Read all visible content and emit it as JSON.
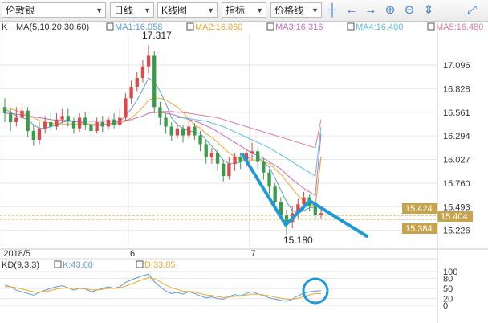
{
  "toolbar": {
    "symbol": "伦敦银",
    "period": "日线",
    "chart_type": "K线图",
    "indicator": "指标",
    "price_line": "价格线",
    "icons": [
      "crosshair-icon",
      "arrow-left-icon",
      "arrow-right-icon",
      "zoom-in-icon",
      "zoom-out-icon",
      "fit-icon",
      "fullscreen-icon"
    ]
  },
  "ma_legend": {
    "prefix": "K",
    "params": "MA(5,10,20,30,60)",
    "items": [
      {
        "label": "MA1:16.058",
        "color": "#5b9bd5"
      },
      {
        "label": "MA2:16.060",
        "color": "#f0a830"
      },
      {
        "label": "MA3:16.316",
        "color": "#c06cc0"
      },
      {
        "label": "MA4:16.400",
        "color": "#5bc0de"
      },
      {
        "label": "MA5:16.480",
        "color": "#e07c9c"
      }
    ]
  },
  "kd_legend": {
    "params": "KD(9,3,3)",
    "items": [
      {
        "label": "K:43.60",
        "color": "#5b9bd5"
      },
      {
        "label": "D:33.85",
        "color": "#f0a830"
      }
    ]
  },
  "price_tags": [
    {
      "value": "15.424",
      "color": "#c8a34a"
    },
    {
      "value": "15.404",
      "color": "#c8a34a"
    },
    {
      "value": "15.384",
      "color": "#c8a34a"
    }
  ],
  "annotations": {
    "high": "17.317",
    "low": "15.180"
  },
  "colors": {
    "up": "#d94a4a",
    "down": "#3a9a4a",
    "drawn_line": "#1e9ad6",
    "grid": "#e6e6e6"
  },
  "chart_data": [
    {
      "type": "candlestick",
      "x_ticks": [
        "2018/5",
        "6",
        "7"
      ],
      "y_ticks": [
        17.096,
        16.828,
        16.561,
        16.294,
        16.027,
        15.76,
        15.493,
        15.226
      ],
      "ylim": [
        15.05,
        17.45
      ],
      "candles": [
        [
          16.62,
          16.55,
          16.72,
          16.45
        ],
        [
          16.55,
          16.45,
          16.6,
          16.35
        ],
        [
          16.45,
          16.5,
          16.62,
          16.4
        ],
        [
          16.5,
          16.58,
          16.65,
          16.45
        ],
        [
          16.58,
          16.35,
          16.62,
          16.28
        ],
        [
          16.35,
          16.25,
          16.42,
          16.18
        ],
        [
          16.25,
          16.38,
          16.45,
          16.2
        ],
        [
          16.38,
          16.45,
          16.52,
          16.32
        ],
        [
          16.45,
          16.4,
          16.55,
          16.35
        ],
        [
          16.4,
          16.48,
          16.55,
          16.36
        ],
        [
          16.48,
          16.52,
          16.6,
          16.44
        ],
        [
          16.52,
          16.46,
          16.6,
          16.4
        ],
        [
          16.46,
          16.38,
          16.5,
          16.32
        ],
        [
          16.38,
          16.5,
          16.55,
          16.34
        ],
        [
          16.5,
          16.42,
          16.56,
          16.36
        ],
        [
          16.42,
          16.35,
          16.46,
          16.3
        ],
        [
          16.35,
          16.45,
          16.5,
          16.32
        ],
        [
          16.45,
          16.4,
          16.52,
          16.34
        ],
        [
          16.4,
          16.48,
          16.52,
          16.36
        ],
        [
          16.48,
          16.42,
          16.55,
          16.38
        ],
        [
          16.42,
          16.5,
          16.6,
          16.4
        ],
        [
          16.5,
          16.72,
          16.78,
          16.46
        ],
        [
          16.72,
          16.85,
          16.92,
          16.66
        ],
        [
          16.85,
          16.95,
          17.02,
          16.8
        ],
        [
          16.95,
          17.08,
          17.15,
          16.9
        ],
        [
          17.08,
          17.2,
          17.317,
          17.0
        ],
        [
          17.2,
          16.62,
          17.25,
          16.55
        ],
        [
          16.62,
          16.5,
          16.68,
          16.42
        ],
        [
          16.5,
          16.4,
          16.55,
          16.32
        ],
        [
          16.4,
          16.3,
          16.45,
          16.24
        ],
        [
          16.3,
          16.38,
          16.44,
          16.26
        ],
        [
          16.38,
          16.3,
          16.42,
          16.22
        ],
        [
          16.3,
          16.4,
          16.46,
          16.26
        ],
        [
          16.4,
          16.3,
          16.44,
          16.25
        ],
        [
          16.3,
          16.2,
          16.35,
          16.12
        ],
        [
          16.2,
          16.05,
          16.25,
          15.98
        ],
        [
          16.05,
          16.1,
          16.16,
          15.98
        ],
        [
          16.1,
          15.98,
          16.14,
          15.9
        ],
        [
          15.98,
          15.84,
          16.02,
          15.78
        ],
        [
          15.84,
          15.98,
          16.05,
          15.8
        ],
        [
          15.98,
          16.06,
          16.1,
          15.9
        ],
        [
          16.06,
          16.0,
          16.1,
          15.92
        ],
        [
          16.0,
          16.1,
          16.14,
          15.94
        ],
        [
          16.1,
          16.12,
          16.22,
          16.02
        ],
        [
          16.12,
          16.0,
          16.16,
          15.92
        ],
        [
          16.0,
          15.88,
          16.04,
          15.8
        ],
        [
          15.88,
          15.72,
          15.92,
          15.64
        ],
        [
          15.72,
          15.55,
          15.76,
          15.48
        ],
        [
          15.55,
          15.4,
          15.6,
          15.35
        ],
        [
          15.4,
          15.32,
          15.46,
          15.18
        ],
        [
          15.32,
          15.42,
          15.5,
          15.25
        ],
        [
          15.42,
          15.52,
          15.58,
          15.36
        ],
        [
          15.52,
          15.6,
          15.66,
          15.46
        ],
        [
          15.6,
          15.5,
          15.64,
          15.44
        ],
        [
          15.5,
          15.4,
          15.54,
          15.34
        ],
        [
          15.4,
          15.42,
          15.46,
          15.36
        ]
      ],
      "ma_series": [
        {
          "name": "MA1",
          "values": [
            16.6,
            16.56,
            16.52,
            16.5,
            16.48,
            16.42,
            16.38,
            16.38,
            16.4,
            16.42,
            16.45,
            16.46,
            16.46,
            16.45,
            16.44,
            16.42,
            16.41,
            16.42,
            16.43,
            16.44,
            16.46,
            16.52,
            16.6,
            16.7,
            16.82,
            16.95,
            16.9,
            16.8,
            16.66,
            16.5,
            16.42,
            16.38,
            16.35,
            16.34,
            16.32,
            16.25,
            16.18,
            16.1,
            16.02,
            15.98,
            15.98,
            16.0,
            16.03,
            16.06,
            16.05,
            16.0,
            15.94,
            15.82,
            15.68,
            15.55,
            15.45,
            15.42,
            15.45,
            15.48,
            15.49,
            16.058
          ]
        },
        {
          "name": "MA2",
          "values": [
            16.62,
            16.6,
            16.58,
            16.55,
            16.53,
            16.5,
            16.47,
            16.45,
            16.44,
            16.43,
            16.43,
            16.43,
            16.43,
            16.43,
            16.43,
            16.43,
            16.43,
            16.43,
            16.43,
            16.43,
            16.44,
            16.46,
            16.5,
            16.55,
            16.62,
            16.7,
            16.72,
            16.72,
            16.7,
            16.66,
            16.62,
            16.56,
            16.48,
            16.42,
            16.38,
            16.32,
            16.28,
            16.22,
            16.16,
            16.1,
            16.06,
            16.04,
            16.02,
            16.02,
            16.02,
            16.0,
            15.98,
            15.92,
            15.86,
            15.78,
            15.7,
            15.62,
            15.56,
            15.52,
            15.5,
            16.06
          ]
        },
        {
          "name": "MA3",
          "values": [
            16.55,
            16.55,
            16.54,
            16.53,
            16.52,
            16.51,
            16.5,
            16.49,
            16.48,
            16.47,
            16.47,
            16.47,
            16.46,
            16.46,
            16.46,
            16.46,
            16.46,
            16.46,
            16.46,
            16.46,
            16.46,
            16.47,
            16.48,
            16.5,
            16.52,
            16.55,
            16.56,
            16.56,
            16.55,
            16.54,
            16.52,
            16.5,
            16.48,
            16.46,
            16.44,
            16.41,
            16.38,
            16.34,
            16.3,
            16.26,
            16.22,
            16.18,
            16.14,
            16.1,
            16.07,
            16.04,
            16.0,
            15.96,
            15.92,
            15.86,
            15.8,
            15.75,
            15.7,
            15.66,
            15.62,
            16.316
          ]
        },
        {
          "name": "MA4",
          "values": [
            null,
            null,
            null,
            null,
            null,
            null,
            null,
            null,
            null,
            null,
            null,
            null,
            null,
            null,
            null,
            null,
            null,
            null,
            null,
            null,
            null,
            null,
            null,
            null,
            null,
            null,
            null,
            null,
            null,
            null,
            16.5,
            16.5,
            16.49,
            16.48,
            16.47,
            16.46,
            16.44,
            16.42,
            16.4,
            16.37,
            16.34,
            16.31,
            16.28,
            16.25,
            16.22,
            16.19,
            16.16,
            16.12,
            16.08,
            16.04,
            16.0,
            15.96,
            15.92,
            15.88,
            15.84,
            16.4
          ]
        },
        {
          "name": "MA5",
          "values": [
            null,
            null,
            null,
            null,
            null,
            null,
            null,
            null,
            null,
            null,
            null,
            null,
            null,
            null,
            null,
            null,
            null,
            null,
            null,
            null,
            null,
            null,
            null,
            null,
            null,
            16.55,
            16.56,
            16.57,
            16.57,
            16.57,
            16.56,
            16.56,
            16.55,
            16.54,
            16.53,
            16.52,
            16.51,
            16.5,
            16.48,
            16.46,
            16.44,
            16.42,
            16.4,
            16.38,
            16.36,
            16.34,
            16.32,
            16.3,
            16.28,
            16.26,
            16.24,
            16.22,
            16.2,
            16.18,
            16.16,
            16.48
          ]
        }
      ]
    },
    {
      "type": "line",
      "y_ticks": [
        100,
        80,
        50,
        20,
        0
      ],
      "ylim": [
        0,
        100
      ],
      "series": [
        {
          "name": "K",
          "values": [
            60,
            55,
            45,
            40,
            35,
            30,
            38,
            45,
            50,
            55,
            58,
            52,
            45,
            50,
            48,
            40,
            45,
            50,
            55,
            50,
            55,
            68,
            75,
            82,
            88,
            92,
            70,
            55,
            42,
            35,
            38,
            33,
            40,
            35,
            28,
            22,
            25,
            20,
            18,
            26,
            32,
            28,
            35,
            40,
            34,
            28,
            22,
            18,
            15,
            12,
            18,
            28,
            36,
            40,
            42,
            43.6
          ]
        },
        {
          "name": "D",
          "values": [
            55,
            55,
            52,
            48,
            44,
            40,
            39,
            41,
            44,
            48,
            51,
            52,
            50,
            50,
            49,
            46,
            46,
            47,
            50,
            50,
            52,
            57,
            63,
            70,
            76,
            82,
            78,
            70,
            60,
            52,
            47,
            42,
            41,
            39,
            35,
            31,
            29,
            26,
            23,
            24,
            27,
            27,
            30,
            33,
            33,
            31,
            28,
            24,
            21,
            18,
            18,
            21,
            26,
            31,
            35,
            33.85
          ]
        }
      ]
    }
  ]
}
